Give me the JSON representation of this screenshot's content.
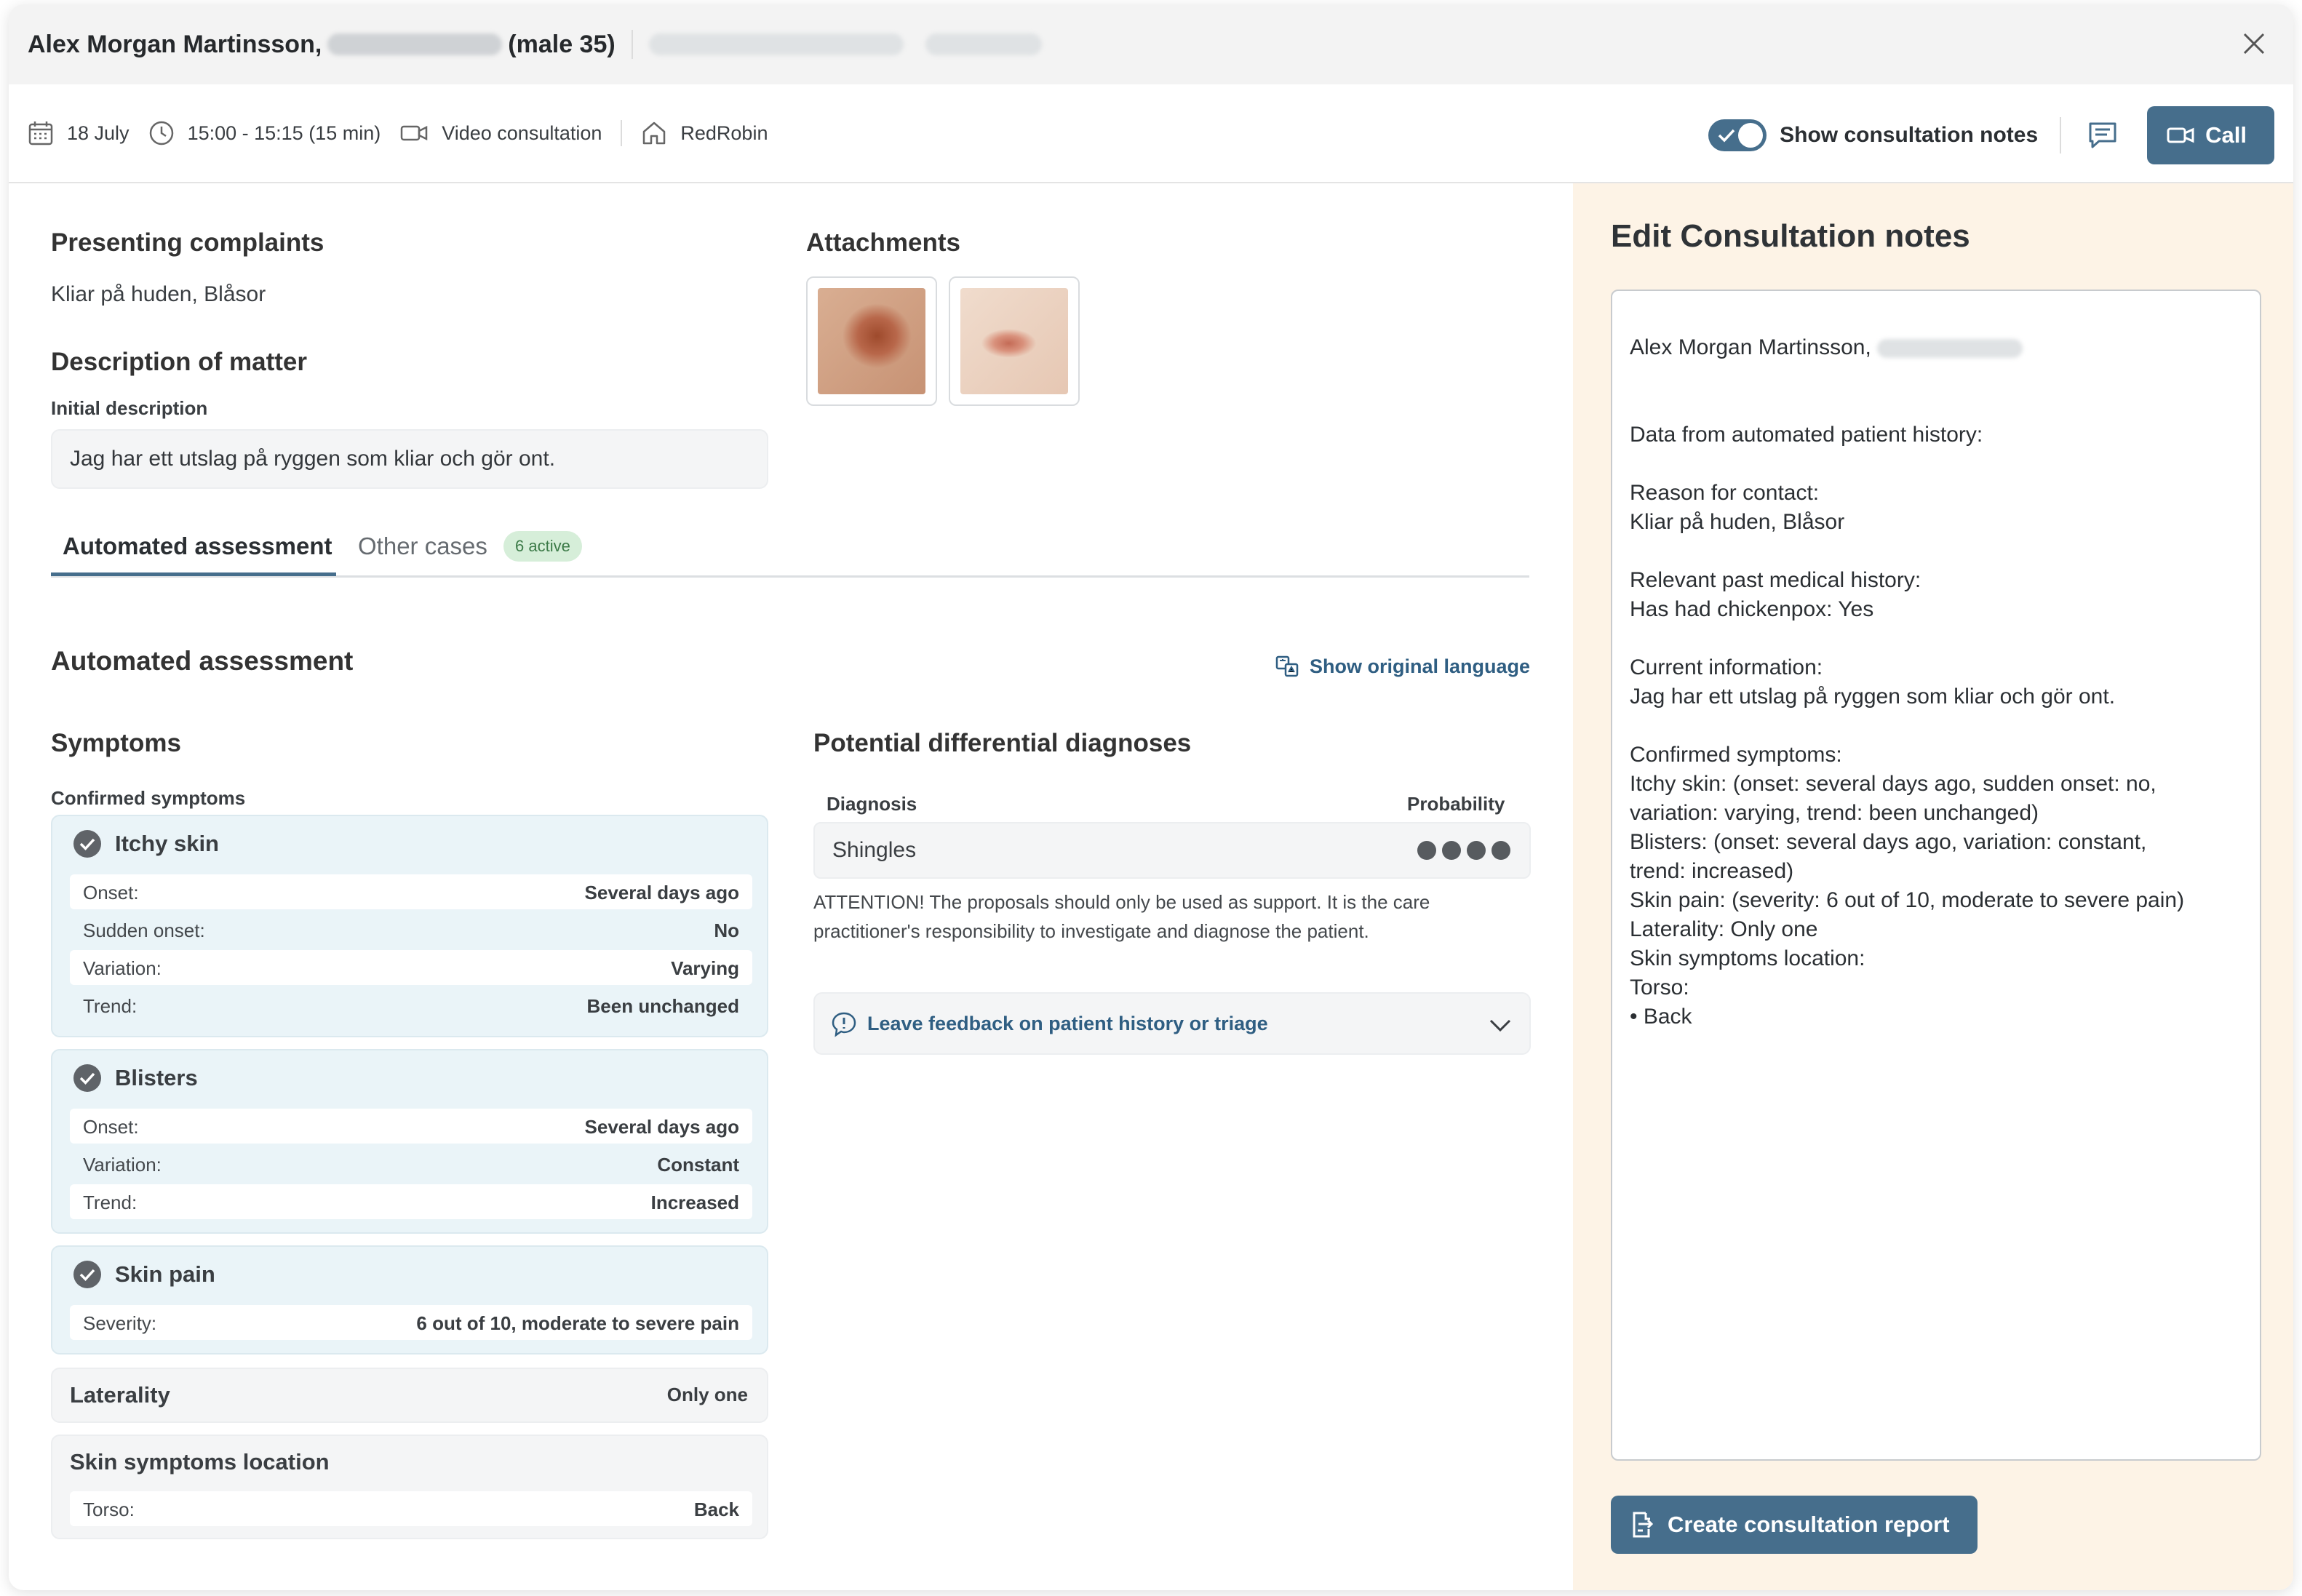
{
  "header": {
    "patient_name": "Alex Morgan Martinsson,",
    "patient_sex_age": "(male 35)"
  },
  "meta": {
    "date": "18 July",
    "time": "15:00 - 15:15 (15 min)",
    "consultation_type": "Video consultation",
    "clinic": "RedRobin",
    "toggle_label": "Show consultation notes",
    "toggle_on": true,
    "call_label": "Call"
  },
  "complaints": {
    "title": "Presenting complaints",
    "value": "Kliar på huden, Blåsor"
  },
  "description": {
    "title": "Description of matter",
    "label": "Initial description",
    "value": "Jag har ett utslag på ryggen som kliar och gör ont."
  },
  "attachments": {
    "title": "Attachments"
  },
  "tabs": [
    {
      "label": "Automated assessment",
      "active": true
    },
    {
      "label": "Other cases",
      "badge": "6 active"
    }
  ],
  "assessment": {
    "title": "Automated assessment",
    "show_language": "Show original language",
    "symptoms_title": "Symptoms",
    "confirmed_label": "Confirmed symptoms",
    "itchy": {
      "name": "Itchy skin",
      "rows": [
        {
          "k": "Onset:",
          "v": "Several days ago"
        },
        {
          "k": "Sudden onset:",
          "v": "No"
        },
        {
          "k": "Variation:",
          "v": "Varying"
        },
        {
          "k": "Trend:",
          "v": "Been unchanged"
        }
      ]
    },
    "blisters": {
      "name": "Blisters",
      "rows": [
        {
          "k": "Onset:",
          "v": "Several days ago"
        },
        {
          "k": "Variation:",
          "v": "Constant"
        },
        {
          "k": "Trend:",
          "v": "Increased"
        }
      ]
    },
    "pain": {
      "name": "Skin pain",
      "rows": [
        {
          "k": "Severity:",
          "v": "6 out of 10, moderate to severe pain"
        }
      ]
    },
    "laterality": {
      "name": "Laterality",
      "value": "Only one"
    },
    "location": {
      "name": "Skin symptoms location",
      "rows": [
        {
          "k": "Torso:",
          "v": "Back"
        }
      ]
    }
  },
  "diagnoses": {
    "title": "Potential differential diagnoses",
    "col_diagnosis": "Diagnosis",
    "col_probability": "Probability",
    "items": [
      {
        "name": "Shingles",
        "probability_dots": 4
      }
    ],
    "attention": "ATTENTION! The proposals should only be used as support. It is the care practitioner's responsibility to investigate and diagnose the patient.",
    "feedback_label": "Leave feedback on patient history or triage"
  },
  "notes": {
    "title": "Edit Consultation notes",
    "name_line": "Alex Morgan Martinsson,",
    "body": "Data from automated patient history:\n\nReason for contact:\nKliar på huden, Blåsor\n\nRelevant past medical history:\nHas had chickenpox: Yes\n\nCurrent information:\nJag har ett utslag på ryggen som kliar och gör ont.\n\nConfirmed symptoms:\nItchy skin: (onset: several days ago, sudden onset: no,\nvariation: varying, trend: been unchanged)\nBlisters: (onset: several days ago, variation: constant,\ntrend: increased)\nSkin pain: (severity: 6 out of 10, moderate to severe pain)\nLaterality: Only one\nSkin symptoms location:\nTorso:\n• Back",
    "create_label": "Create consultation report"
  },
  "colors": {
    "accent": "#466e8c",
    "link": "#2f5e82",
    "notes_bg": "#fdf3e6",
    "symptom_bg": "#eaf4f8",
    "badge_bg": "#d6eed9"
  }
}
